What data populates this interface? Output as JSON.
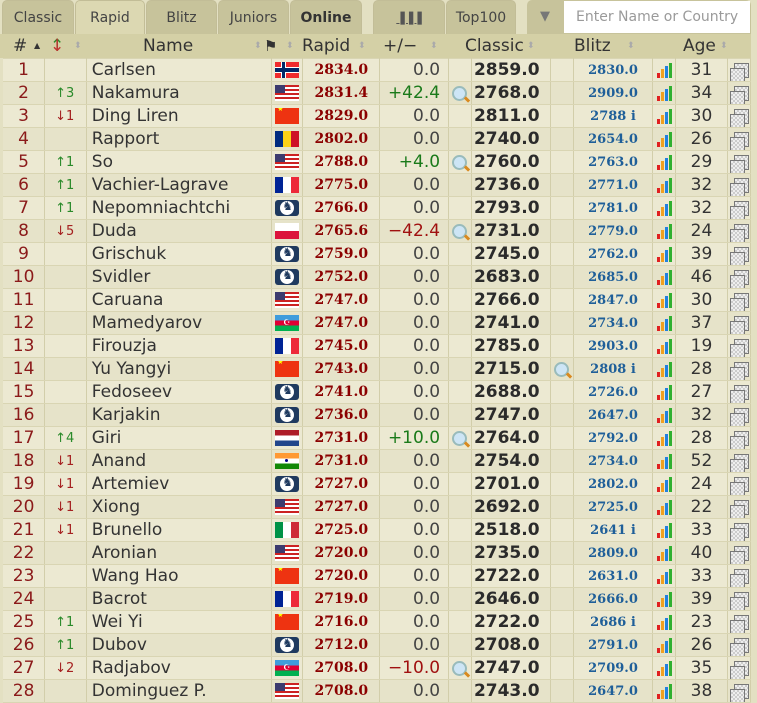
{
  "tabs": [
    {
      "label": "Classic",
      "active": false
    },
    {
      "label": "Rapid",
      "active": true
    },
    {
      "label": "Blitz",
      "active": false
    },
    {
      "label": "Juniors",
      "active": false
    },
    {
      "label": "Online",
      "active": false,
      "bold": true
    },
    {
      "label": "chart-icon",
      "active": false
    },
    {
      "label": "Top100",
      "active": false
    }
  ],
  "search": {
    "placeholder": "Enter Name or Country",
    "filter_icon": "filter-icon"
  },
  "header": {
    "rank": "#",
    "name": "Name",
    "rapid": "Rapid",
    "diff": "+/−",
    "classic": "Classic",
    "blitz": "Blitz",
    "age": "Age"
  },
  "colors": {
    "rank": "#8b1a1a",
    "rapid": "#8b0000",
    "blitz": "#1f5f99",
    "up": "#2a8a2a",
    "down": "#a52020",
    "background": "#e3e0c2"
  },
  "rows": [
    {
      "rank": "1",
      "chg": "",
      "dir": "",
      "name": "Carlsen",
      "flag": "no",
      "rapid": "2834.0",
      "diff": "0.0",
      "ds": "",
      "mag1": false,
      "classic": "2859.0",
      "mag2": false,
      "blitz": "2830.0",
      "age": "31"
    },
    {
      "rank": "2",
      "chg": "↑3",
      "dir": "up",
      "name": "Nakamura",
      "flag": "us",
      "rapid": "2831.4",
      "diff": "+42.4",
      "ds": "pos",
      "mag1": true,
      "classic": "2768.0",
      "mag2": false,
      "blitz": "2909.0",
      "age": "34"
    },
    {
      "rank": "3",
      "chg": "↓1",
      "dir": "down",
      "name": "Ding Liren",
      "flag": "cn",
      "rapid": "2829.0",
      "diff": "0.0",
      "ds": "",
      "mag1": false,
      "classic": "2811.0",
      "mag2": false,
      "blitz": "2788 i",
      "age": "30"
    },
    {
      "rank": "4",
      "chg": "",
      "dir": "",
      "name": "Rapport",
      "flag": "ro",
      "rapid": "2802.0",
      "diff": "0.0",
      "ds": "",
      "mag1": false,
      "classic": "2740.0",
      "mag2": false,
      "blitz": "2654.0",
      "age": "26"
    },
    {
      "rank": "5",
      "chg": "↑1",
      "dir": "up",
      "name": "So",
      "flag": "us",
      "rapid": "2788.0",
      "diff": "+4.0",
      "ds": "pos",
      "mag1": true,
      "classic": "2760.0",
      "mag2": false,
      "blitz": "2763.0",
      "age": "29"
    },
    {
      "rank": "6",
      "chg": "↑1",
      "dir": "up",
      "name": "Vachier-Lagrave",
      "flag": "fr",
      "rapid": "2775.0",
      "diff": "0.0",
      "ds": "",
      "mag1": false,
      "classic": "2736.0",
      "mag2": false,
      "blitz": "2771.0",
      "age": "32"
    },
    {
      "rank": "7",
      "chg": "↑1",
      "dir": "up",
      "name": "Nepomniachtchi",
      "flag": "fide",
      "rapid": "2766.0",
      "diff": "0.0",
      "ds": "",
      "mag1": false,
      "classic": "2793.0",
      "mag2": false,
      "blitz": "2781.0",
      "age": "32"
    },
    {
      "rank": "8",
      "chg": "↓5",
      "dir": "down",
      "name": "Duda",
      "flag": "pl",
      "rapid": "2765.6",
      "diff": "−42.4",
      "ds": "neg",
      "mag1": true,
      "classic": "2731.0",
      "mag2": false,
      "blitz": "2779.0",
      "age": "24"
    },
    {
      "rank": "9",
      "chg": "",
      "dir": "",
      "name": "Grischuk",
      "flag": "fide",
      "rapid": "2759.0",
      "diff": "0.0",
      "ds": "",
      "mag1": false,
      "classic": "2745.0",
      "mag2": false,
      "blitz": "2762.0",
      "age": "39"
    },
    {
      "rank": "10",
      "chg": "",
      "dir": "",
      "name": "Svidler",
      "flag": "fide",
      "rapid": "2752.0",
      "diff": "0.0",
      "ds": "",
      "mag1": false,
      "classic": "2683.0",
      "mag2": false,
      "blitz": "2685.0",
      "age": "46"
    },
    {
      "rank": "11",
      "chg": "",
      "dir": "",
      "name": "Caruana",
      "flag": "us",
      "rapid": "2747.0",
      "diff": "0.0",
      "ds": "",
      "mag1": false,
      "classic": "2766.0",
      "mag2": false,
      "blitz": "2847.0",
      "age": "30"
    },
    {
      "rank": "12",
      "chg": "",
      "dir": "",
      "name": "Mamedyarov",
      "flag": "az",
      "rapid": "2747.0",
      "diff": "0.0",
      "ds": "",
      "mag1": false,
      "classic": "2741.0",
      "mag2": false,
      "blitz": "2734.0",
      "age": "37"
    },
    {
      "rank": "13",
      "chg": "",
      "dir": "",
      "name": "Firouzja",
      "flag": "fr",
      "rapid": "2745.0",
      "diff": "0.0",
      "ds": "",
      "mag1": false,
      "classic": "2785.0",
      "mag2": false,
      "blitz": "2903.0",
      "age": "19"
    },
    {
      "rank": "14",
      "chg": "",
      "dir": "",
      "name": "Yu Yangyi",
      "flag": "cn",
      "rapid": "2743.0",
      "diff": "0.0",
      "ds": "",
      "mag1": false,
      "classic": "2715.0",
      "mag2": true,
      "blitz": "2808 i",
      "age": "28"
    },
    {
      "rank": "15",
      "chg": "",
      "dir": "",
      "name": "Fedoseev",
      "flag": "fide",
      "rapid": "2741.0",
      "diff": "0.0",
      "ds": "",
      "mag1": false,
      "classic": "2688.0",
      "mag2": false,
      "blitz": "2726.0",
      "age": "27"
    },
    {
      "rank": "16",
      "chg": "",
      "dir": "",
      "name": "Karjakin",
      "flag": "fide",
      "rapid": "2736.0",
      "diff": "0.0",
      "ds": "",
      "mag1": false,
      "classic": "2747.0",
      "mag2": false,
      "blitz": "2647.0",
      "age": "32"
    },
    {
      "rank": "17",
      "chg": "↑4",
      "dir": "up",
      "name": "Giri",
      "flag": "nl",
      "rapid": "2731.0",
      "diff": "+10.0",
      "ds": "pos",
      "mag1": true,
      "classic": "2764.0",
      "mag2": false,
      "blitz": "2792.0",
      "age": "28"
    },
    {
      "rank": "18",
      "chg": "↓1",
      "dir": "down",
      "name": "Anand",
      "flag": "in",
      "rapid": "2731.0",
      "diff": "0.0",
      "ds": "",
      "mag1": false,
      "classic": "2754.0",
      "mag2": false,
      "blitz": "2734.0",
      "age": "52"
    },
    {
      "rank": "19",
      "chg": "↓1",
      "dir": "down",
      "name": "Artemiev",
      "flag": "fide",
      "rapid": "2727.0",
      "diff": "0.0",
      "ds": "",
      "mag1": false,
      "classic": "2701.0",
      "mag2": false,
      "blitz": "2802.0",
      "age": "24"
    },
    {
      "rank": "20",
      "chg": "↓1",
      "dir": "down",
      "name": "Xiong",
      "flag": "us",
      "rapid": "2727.0",
      "diff": "0.0",
      "ds": "",
      "mag1": false,
      "classic": "2692.0",
      "mag2": false,
      "blitz": "2725.0",
      "age": "22"
    },
    {
      "rank": "21",
      "chg": "↓1",
      "dir": "down",
      "name": "Brunello",
      "flag": "it",
      "rapid": "2725.0",
      "diff": "0.0",
      "ds": "",
      "mag1": false,
      "classic": "2518.0",
      "mag2": false,
      "blitz": "2641 i",
      "age": "33"
    },
    {
      "rank": "22",
      "chg": "",
      "dir": "",
      "name": "Aronian",
      "flag": "us",
      "rapid": "2720.0",
      "diff": "0.0",
      "ds": "",
      "mag1": false,
      "classic": "2735.0",
      "mag2": false,
      "blitz": "2809.0",
      "age": "40"
    },
    {
      "rank": "23",
      "chg": "",
      "dir": "",
      "name": "Wang Hao",
      "flag": "cn",
      "rapid": "2720.0",
      "diff": "0.0",
      "ds": "",
      "mag1": false,
      "classic": "2722.0",
      "mag2": false,
      "blitz": "2631.0",
      "age": "33"
    },
    {
      "rank": "24",
      "chg": "",
      "dir": "",
      "name": "Bacrot",
      "flag": "fr",
      "rapid": "2719.0",
      "diff": "0.0",
      "ds": "",
      "mag1": false,
      "classic": "2646.0",
      "mag2": false,
      "blitz": "2666.0",
      "age": "39"
    },
    {
      "rank": "25",
      "chg": "↑1",
      "dir": "up",
      "name": "Wei Yi",
      "flag": "cn",
      "rapid": "2716.0",
      "diff": "0.0",
      "ds": "",
      "mag1": false,
      "classic": "2722.0",
      "mag2": false,
      "blitz": "2686 i",
      "age": "23"
    },
    {
      "rank": "26",
      "chg": "↑1",
      "dir": "up",
      "name": "Dubov",
      "flag": "fide",
      "rapid": "2712.0",
      "diff": "0.0",
      "ds": "",
      "mag1": false,
      "classic": "2708.0",
      "mag2": false,
      "blitz": "2791.0",
      "age": "26"
    },
    {
      "rank": "27",
      "chg": "↓2",
      "dir": "down",
      "name": "Radjabov",
      "flag": "az",
      "rapid": "2708.0",
      "diff": "−10.0",
      "ds": "neg",
      "mag1": true,
      "classic": "2747.0",
      "mag2": false,
      "blitz": "2709.0",
      "age": "35"
    },
    {
      "rank": "28",
      "chg": "",
      "dir": "",
      "name": "Dominguez P.",
      "flag": "us",
      "rapid": "2708.0",
      "diff": "0.0",
      "ds": "",
      "mag1": false,
      "classic": "2743.0",
      "mag2": false,
      "blitz": "2647.0",
      "age": "38"
    }
  ]
}
